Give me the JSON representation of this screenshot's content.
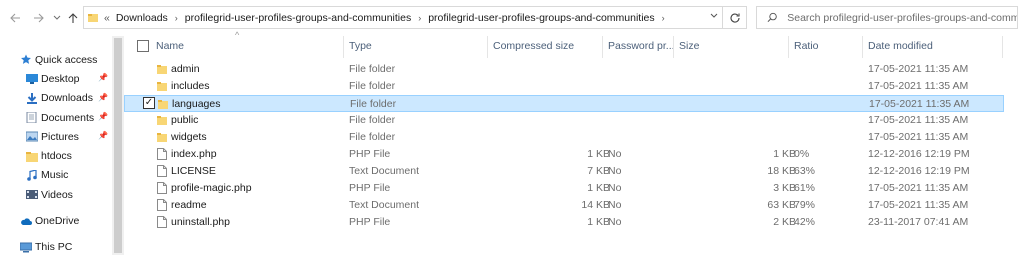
{
  "nav": {
    "back_icon": "arrow-left-icon",
    "forward_icon": "arrow-right-icon",
    "recent_icon": "chevron-down-icon",
    "up_icon": "arrow-up-icon"
  },
  "address": {
    "overflow": "«",
    "crumbs": [
      "Downloads",
      "profilegrid-user-profiles-groups-and-communities",
      "profilegrid-user-profiles-groups-and-communities"
    ]
  },
  "search": {
    "placeholder": "Search profilegrid-user-profiles-groups-and-commu..."
  },
  "sidebar": {
    "items": [
      {
        "label": "Quick access",
        "icon": "star-icon",
        "pinned": false
      },
      {
        "label": "Desktop",
        "icon": "desktop-icon",
        "pinned": true
      },
      {
        "label": "Downloads",
        "icon": "download-icon",
        "pinned": true
      },
      {
        "label": "Documents",
        "icon": "documents-icon",
        "pinned": true
      },
      {
        "label": "Pictures",
        "icon": "pictures-icon",
        "pinned": true
      },
      {
        "label": "htdocs",
        "icon": "folder-icon",
        "pinned": false
      },
      {
        "label": "Music",
        "icon": "music-icon",
        "pinned": false
      },
      {
        "label": "Videos",
        "icon": "videos-icon",
        "pinned": false
      },
      {
        "label": "OneDrive",
        "icon": "cloud-icon",
        "pinned": false
      },
      {
        "label": "This PC",
        "icon": "computer-icon",
        "pinned": false
      }
    ]
  },
  "columns": {
    "name": "Name",
    "type": "Type",
    "compressed": "Compressed size",
    "password": "Password pr...",
    "size": "Size",
    "ratio": "Ratio",
    "date": "Date modified"
  },
  "files": [
    {
      "name": "admin",
      "type": "File folder",
      "compressed": "",
      "password": "",
      "size": "",
      "ratio": "",
      "date": "17-05-2021 11:35 AM",
      "icon": "folder-icon",
      "selected": false
    },
    {
      "name": "includes",
      "type": "File folder",
      "compressed": "",
      "password": "",
      "size": "",
      "ratio": "",
      "date": "17-05-2021 11:35 AM",
      "icon": "folder-icon",
      "selected": false
    },
    {
      "name": "languages",
      "type": "File folder",
      "compressed": "",
      "password": "",
      "size": "",
      "ratio": "",
      "date": "17-05-2021 11:35 AM",
      "icon": "folder-icon",
      "selected": true
    },
    {
      "name": "public",
      "type": "File folder",
      "compressed": "",
      "password": "",
      "size": "",
      "ratio": "",
      "date": "17-05-2021 11:35 AM",
      "icon": "folder-icon",
      "selected": false
    },
    {
      "name": "widgets",
      "type": "File folder",
      "compressed": "",
      "password": "",
      "size": "",
      "ratio": "",
      "date": "17-05-2021 11:35 AM",
      "icon": "folder-icon",
      "selected": false
    },
    {
      "name": "index.php",
      "type": "PHP File",
      "compressed": "1 KB",
      "password": "No",
      "size": "1 KB",
      "ratio": "0%",
      "date": "12-12-2016 12:19 PM",
      "icon": "file-icon",
      "selected": false
    },
    {
      "name": "LICENSE",
      "type": "Text Document",
      "compressed": "7 KB",
      "password": "No",
      "size": "18 KB",
      "ratio": "63%",
      "date": "12-12-2016 12:19 PM",
      "icon": "file-icon",
      "selected": false
    },
    {
      "name": "profile-magic.php",
      "type": "PHP File",
      "compressed": "1 KB",
      "password": "No",
      "size": "3 KB",
      "ratio": "61%",
      "date": "17-05-2021 11:35 AM",
      "icon": "file-icon",
      "selected": false
    },
    {
      "name": "readme",
      "type": "Text Document",
      "compressed": "14 KB",
      "password": "No",
      "size": "63 KB",
      "ratio": "79%",
      "date": "17-05-2021 11:35 AM",
      "icon": "file-icon",
      "selected": false
    },
    {
      "name": "uninstall.php",
      "type": "PHP File",
      "compressed": "1 KB",
      "password": "No",
      "size": "2 KB",
      "ratio": "42%",
      "date": "23-11-2017 07:41 AM",
      "icon": "file-icon",
      "selected": false
    }
  ],
  "colors": {
    "selection_bg": "#cce8ff",
    "selection_border": "#99d1ff",
    "folder_yellow": "#f8d675",
    "header_text": "#4c607a"
  }
}
